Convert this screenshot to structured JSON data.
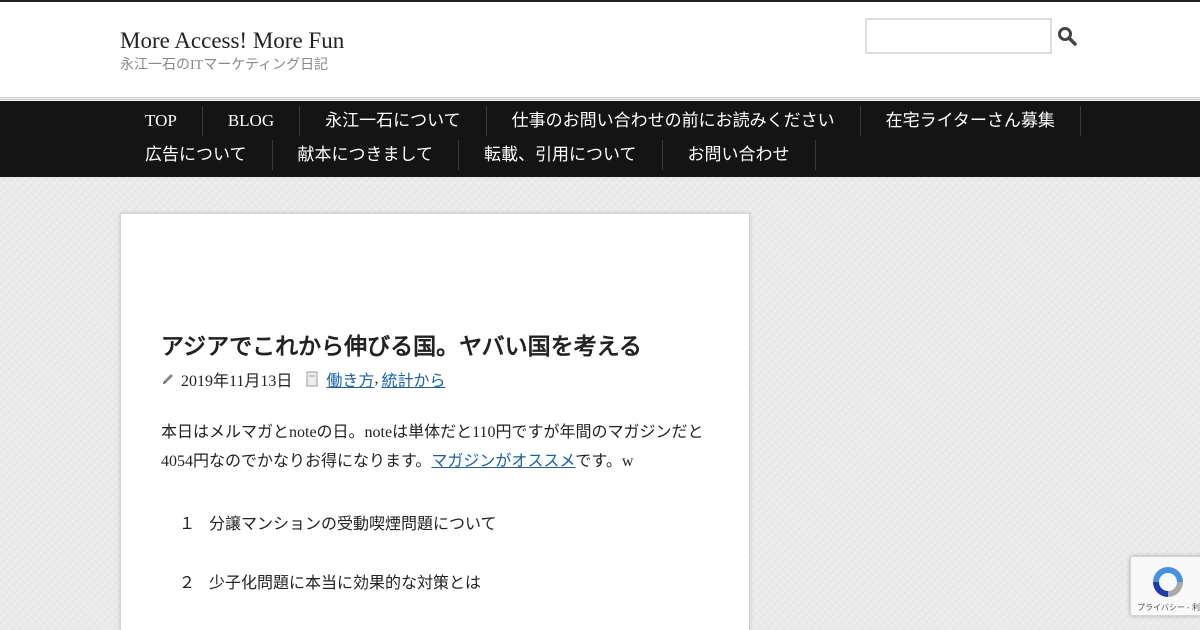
{
  "site": {
    "title": "More Access! More Fun",
    "description": "永江一石のITマーケティング日記"
  },
  "search": {
    "placeholder": ""
  },
  "nav": {
    "row1": [
      "TOP",
      "BLOG",
      "永江一石について",
      "仕事のお問い合わせの前にお読みください",
      "在宅ライターさん募集"
    ],
    "row2": [
      "広告について",
      "献本につきまして",
      "転載、引用について",
      "お問い合わせ"
    ]
  },
  "post": {
    "title": "アジアでこれから伸びる国。ヤバい国を考える",
    "date": "2019年11月13日",
    "categories": [
      "働き方",
      "統計から"
    ],
    "category_separator": ",",
    "body_text_1": "本日はメルマガとnoteの日。noteは単体だと110円ですが年間のマガジンだと4054円なのでかなりお得になります。",
    "body_link": "マガジンがオススメ",
    "body_text_2": "です。w",
    "toc": [
      {
        "num": "１",
        "text": "分譲マンションの受動喫煙問題について"
      },
      {
        "num": "２",
        "text": "少子化問題に本当に効果的な対策とは"
      }
    ]
  },
  "recaptcha": {
    "footer": "プライバシー - 利用規約"
  },
  "colors": {
    "nav_bg": "#141414",
    "link": "#1a5fa8",
    "page_bg": "#efefef"
  },
  "icons": [
    "search-icon",
    "pencil-icon",
    "folder-icon",
    "recaptcha-icon"
  ]
}
